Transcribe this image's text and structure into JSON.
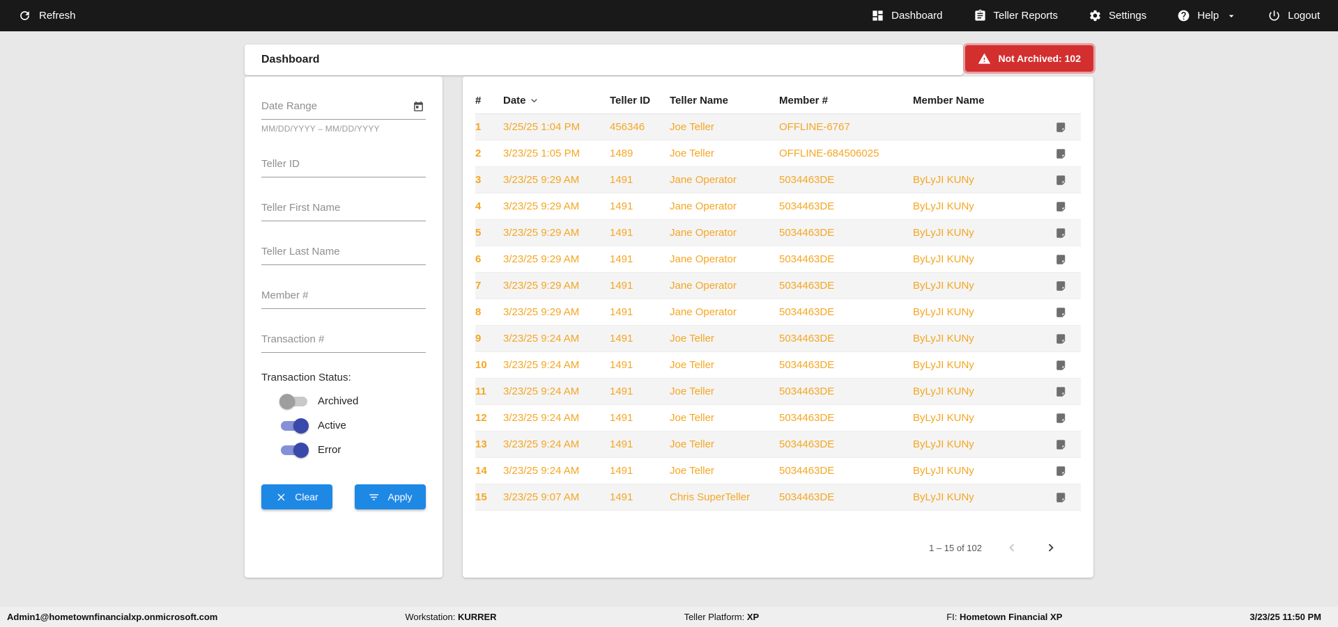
{
  "topbar": {
    "refresh_label": "Refresh",
    "items": [
      {
        "label": "Dashboard"
      },
      {
        "label": "Teller Reports"
      },
      {
        "label": "Settings"
      },
      {
        "label": "Help"
      },
      {
        "label": "Logout"
      }
    ]
  },
  "page": {
    "title": "Dashboard",
    "not_archived_badge": "Not Archived: 102"
  },
  "filters": {
    "date_range_placeholder": "Date Range",
    "date_range_hint": "MM/DD/YYYY – MM/DD/YYYY",
    "teller_id_placeholder": "Teller ID",
    "teller_first_placeholder": "Teller First Name",
    "teller_last_placeholder": "Teller Last Name",
    "member_placeholder": "Member #",
    "transaction_placeholder": "Transaction #",
    "status_label": "Transaction Status:",
    "toggles": [
      {
        "label": "Archived",
        "on": false
      },
      {
        "label": "Active",
        "on": true
      },
      {
        "label": "Error",
        "on": true
      }
    ],
    "clear_label": "Clear",
    "apply_label": "Apply"
  },
  "table": {
    "columns": [
      "#",
      "Date",
      "Teller ID",
      "Teller Name",
      "Member #",
      "Member Name"
    ],
    "rows": [
      {
        "num": "1",
        "date": "3/25/25 1:04 PM",
        "teller_id": "456346",
        "teller_name": "Joe Teller",
        "member_number": "OFFLINE-6767",
        "member_name": ""
      },
      {
        "num": "2",
        "date": "3/23/25 1:05 PM",
        "teller_id": "1489",
        "teller_name": "Joe Teller",
        "member_number": "OFFLINE-684506025",
        "member_name": ""
      },
      {
        "num": "3",
        "date": "3/23/25 9:29 AM",
        "teller_id": "1491",
        "teller_name": "Jane Operator",
        "member_number": "5034463DE",
        "member_name": "ByLyJI KUNy"
      },
      {
        "num": "4",
        "date": "3/23/25 9:29 AM",
        "teller_id": "1491",
        "teller_name": "Jane Operator",
        "member_number": "5034463DE",
        "member_name": "ByLyJI KUNy"
      },
      {
        "num": "5",
        "date": "3/23/25 9:29 AM",
        "teller_id": "1491",
        "teller_name": "Jane Operator",
        "member_number": "5034463DE",
        "member_name": "ByLyJI KUNy"
      },
      {
        "num": "6",
        "date": "3/23/25 9:29 AM",
        "teller_id": "1491",
        "teller_name": "Jane Operator",
        "member_number": "5034463DE",
        "member_name": "ByLyJI KUNy"
      },
      {
        "num": "7",
        "date": "3/23/25 9:29 AM",
        "teller_id": "1491",
        "teller_name": "Jane Operator",
        "member_number": "5034463DE",
        "member_name": "ByLyJI KUNy"
      },
      {
        "num": "8",
        "date": "3/23/25 9:29 AM",
        "teller_id": "1491",
        "teller_name": "Jane Operator",
        "member_number": "5034463DE",
        "member_name": "ByLyJI KUNy"
      },
      {
        "num": "9",
        "date": "3/23/25 9:24 AM",
        "teller_id": "1491",
        "teller_name": "Joe Teller",
        "member_number": "5034463DE",
        "member_name": "ByLyJI KUNy"
      },
      {
        "num": "10",
        "date": "3/23/25 9:24 AM",
        "teller_id": "1491",
        "teller_name": "Joe Teller",
        "member_number": "5034463DE",
        "member_name": "ByLyJI KUNy"
      },
      {
        "num": "11",
        "date": "3/23/25 9:24 AM",
        "teller_id": "1491",
        "teller_name": "Joe Teller",
        "member_number": "5034463DE",
        "member_name": "ByLyJI KUNy"
      },
      {
        "num": "12",
        "date": "3/23/25 9:24 AM",
        "teller_id": "1491",
        "teller_name": "Joe Teller",
        "member_number": "5034463DE",
        "member_name": "ByLyJI KUNy"
      },
      {
        "num": "13",
        "date": "3/23/25 9:24 AM",
        "teller_id": "1491",
        "teller_name": "Joe Teller",
        "member_number": "5034463DE",
        "member_name": "ByLyJI KUNy"
      },
      {
        "num": "14",
        "date": "3/23/25 9:24 AM",
        "teller_id": "1491",
        "teller_name": "Joe Teller",
        "member_number": "5034463DE",
        "member_name": "ByLyJI KUNy"
      },
      {
        "num": "15",
        "date": "3/23/25 9:07 AM",
        "teller_id": "1491",
        "teller_name": "Chris SuperTeller",
        "member_number": "5034463DE",
        "member_name": "ByLyJI KUNy"
      }
    ],
    "pagination": "1 – 15 of 102"
  },
  "footer": {
    "user": "Admin1@hometownfinancialxp.onmicrosoft.com",
    "workstation_label": "Workstation:",
    "workstation": "KURRER",
    "platform_label": "Teller Platform:",
    "platform": "XP",
    "fi_label": "FI:",
    "fi": "Hometown Financial XP",
    "datetime": "3/23/25 11:50 PM"
  },
  "colors": {
    "accent_blue": "#1e88e5",
    "row_orange": "#f5a623",
    "badge_red": "#d32f2f",
    "toggle_on_blue": "#3949ab",
    "topbar_black": "#191919"
  }
}
